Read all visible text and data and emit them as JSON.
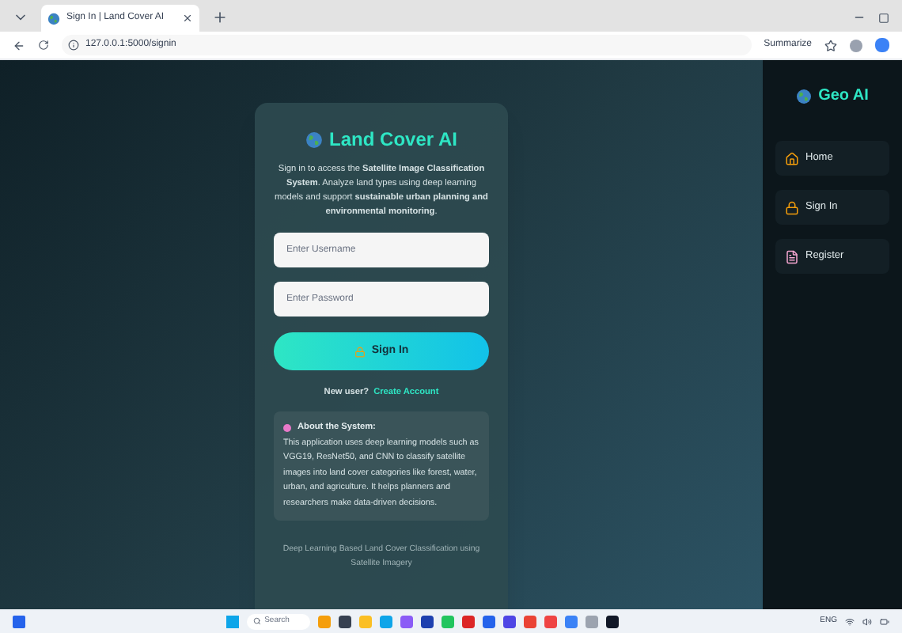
{
  "browser": {
    "tab_title": "Sign In | Land Cover AI",
    "url": "127.0.0.1:5000/signin",
    "summarize": "Summarize"
  },
  "card": {
    "title": "Land Cover AI",
    "intro": "Sign in to access the **Satellite Image Classification System**. Analyze land types using deep learning models and support **sustainable urban planning and environmental monitoring**.",
    "username": {
      "placeholder": "Enter Username"
    },
    "password": {
      "placeholder": "Enter Password"
    },
    "button": "Sign In",
    "new_user": "New user?",
    "create_link": "Create Account",
    "about_title": "About the System:",
    "about_text": "This application uses deep learning models such as VGG19, ResNet50, and CNN to classify satellite images into land cover categories like forest, water, urban, and agriculture. It helps planners and researchers make data-driven decisions.",
    "footer": "Deep Learning Based Land Cover Classification using Satellite Imagery"
  },
  "sidebar": {
    "brand": "Geo AI",
    "items": [
      {
        "label": "Home",
        "kind": "home"
      },
      {
        "label": "Sign In",
        "kind": "signin"
      },
      {
        "label": "Register",
        "kind": "register"
      }
    ]
  },
  "taskbar": {
    "search": {
      "placeholder": "Search"
    },
    "language": "ENG"
  }
}
